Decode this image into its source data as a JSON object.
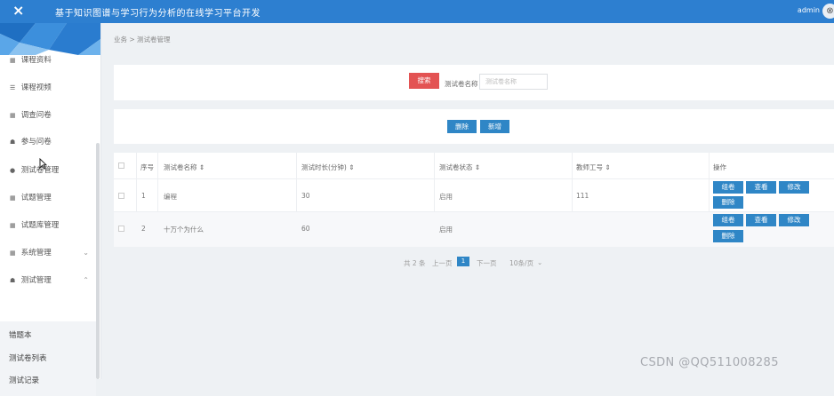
{
  "topbar": {
    "close_icon": "×",
    "title": "基于知识图谱与学习行为分析的在线学习平台开发",
    "user": "admin",
    "logout_icon": "⊗"
  },
  "sidebar": {
    "items": [
      {
        "label": "课程资料",
        "icon": "▦"
      },
      {
        "label": "课程视频",
        "icon": "☰"
      },
      {
        "label": "调查问卷",
        "icon": "▦"
      },
      {
        "label": "参与问卷",
        "icon": "☗"
      },
      {
        "label": "测试卷管理",
        "icon": "●"
      },
      {
        "label": "试题管理",
        "icon": "▦"
      },
      {
        "label": "试题库管理",
        "icon": "▦"
      },
      {
        "label": "系统管理",
        "icon": "▦",
        "chevron": "⌄"
      },
      {
        "label": "测试管理",
        "icon": "☗",
        "chevron": "⌃"
      }
    ],
    "subitems": [
      "错题本",
      "测试卷列表",
      "测试记录"
    ]
  },
  "breadcrumb": "业务 > 测试卷管理",
  "search": {
    "button": "搜索",
    "label": "测试卷名称",
    "placeholder": "测试卷名称"
  },
  "actions": {
    "delete": "删除",
    "add": "新增"
  },
  "table": {
    "headers": [
      "序号",
      "测试卷名称 ⇕",
      "测试时长(分钟) ⇕",
      "测试卷状态 ⇕",
      "教师工号 ⇕",
      "操作"
    ],
    "rows": [
      {
        "index": "1",
        "name": "编程",
        "duration": "30",
        "status": "启用",
        "teacher": "111"
      },
      {
        "index": "2",
        "name": "十万个为什么",
        "duration": "60",
        "status": "启用",
        "teacher": ""
      }
    ],
    "row_actions": [
      "组卷",
      "查看",
      "修改",
      "删除"
    ]
  },
  "pagination": {
    "total": "共 2 条",
    "prev": "上一页",
    "current": "1",
    "next": "下一页",
    "page_size": "10条/页",
    "page_size_arrow": "⌄"
  },
  "watermark": "CSDN @QQ511008285",
  "colors": {
    "topbar": "#2d7fd0",
    "search_button": "#e35353",
    "action_button": "#2f86c6"
  }
}
